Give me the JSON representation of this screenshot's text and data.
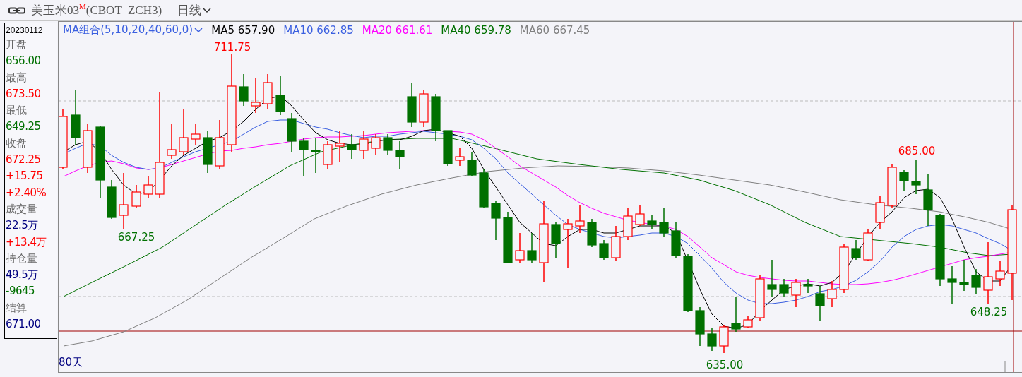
{
  "title": {
    "text": "美玉米03$^{M}$(CBOT  ZCH3)",
    "period": "日线"
  },
  "info": {
    "date": "20230112",
    "items": [
      {
        "text": "开盘",
        "kind": "label"
      },
      {
        "text": "656.00",
        "kind": "value",
        "color": "#007000"
      },
      {
        "text": "最高",
        "kind": "label"
      },
      {
        "text": "673.50",
        "kind": "value",
        "color": "#ff0000"
      },
      {
        "text": "最低",
        "kind": "label"
      },
      {
        "text": "649.25",
        "kind": "value",
        "color": "#007000"
      },
      {
        "text": "收盘",
        "kind": "label"
      },
      {
        "text": "672.25",
        "kind": "value",
        "color": "#ff0000"
      },
      {
        "text": "+15.75",
        "kind": "value",
        "color": "#ff0000"
      },
      {
        "text": "+2.40%",
        "kind": "value",
        "color": "#ff0000"
      },
      {
        "text": "成交量",
        "kind": "label"
      },
      {
        "text": "22.5万",
        "kind": "value",
        "color": "#000080"
      },
      {
        "text": "+13.4万",
        "kind": "value",
        "color": "#ff0000"
      },
      {
        "text": "持仓量",
        "kind": "label"
      },
      {
        "text": "49.5万",
        "kind": "value",
        "color": "#000080"
      },
      {
        "text": "-9645",
        "kind": "value",
        "color": "#007000"
      },
      {
        "text": "结算",
        "kind": "label"
      },
      {
        "text": "671.00",
        "kind": "value",
        "color": "#000080"
      }
    ]
  },
  "legend": [
    {
      "text": "MA组合(5,10,20,40,60,0)",
      "color": "#3a5fe0",
      "kind": "dropdown"
    },
    {
      "text": "MA5 657.90",
      "color": "#000000",
      "kind": "value"
    },
    {
      "text": "MA10 662.85",
      "color": "#3a5fe0",
      "kind": "value"
    },
    {
      "text": "MA20 661.61",
      "color": "#ff00ff",
      "kind": "value"
    },
    {
      "text": "MA40 659.78",
      "color": "#007000",
      "kind": "value"
    },
    {
      "text": "MA60 667.45",
      "color": "#808080",
      "kind": "value"
    }
  ],
  "annotations": [
    {
      "text": "711.75",
      "color": "#ff0000"
    },
    {
      "text": "667.25",
      "color": "#007000"
    },
    {
      "text": "685.00",
      "color": "#ff0000"
    },
    {
      "text": "635.00",
      "color": "#007000"
    },
    {
      "text": "648.25",
      "color": "#007000"
    }
  ],
  "footer": {
    "range": "80天"
  }
}
